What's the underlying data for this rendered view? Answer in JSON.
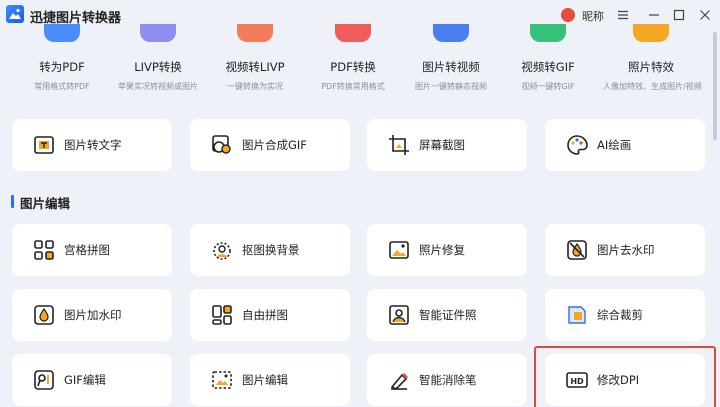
{
  "app": {
    "title": "迅捷图片转换器",
    "user_name": "昵称"
  },
  "window_controls": {
    "menu": "≡",
    "minimize": "—",
    "maximize": "□",
    "close": "✕"
  },
  "top_tools": [
    {
      "title": "转为PDF",
      "subtitle": "常用格式转PDF",
      "color": "#4a8cff"
    },
    {
      "title": "LIVP转换",
      "subtitle": "苹果实况转视频或图片",
      "color": "#8f8df0"
    },
    {
      "title": "视频转LIVP",
      "subtitle": "一键转换为实况",
      "color": "#f47c5c"
    },
    {
      "title": "PDF转换",
      "subtitle": "PDF转换常用格式",
      "color": "#f05b5b"
    },
    {
      "title": "图片转视频",
      "subtitle": "图片一键转静态视频",
      "color": "#4a7df0"
    },
    {
      "title": "视频转GIF",
      "subtitle": "视频一键转GIF",
      "color": "#37c27c"
    },
    {
      "title": "照片特效",
      "subtitle": "人像加特效、生成图片/视频",
      "color": "#f5a623"
    }
  ],
  "row1": [
    {
      "label": "图片转文字",
      "icon": "image-to-text-icon"
    },
    {
      "label": "图片合成GIF",
      "icon": "gif-compose-icon"
    },
    {
      "label": "屏幕截图",
      "icon": "screenshot-icon"
    },
    {
      "label": "AI绘画",
      "icon": "palette-icon"
    }
  ],
  "section": {
    "title": "图片编辑"
  },
  "edit_tools": [
    {
      "label": "宫格拼图",
      "icon": "grid-icon"
    },
    {
      "label": "抠图换背景",
      "icon": "cutout-icon"
    },
    {
      "label": "照片修复",
      "icon": "photo-repair-icon"
    },
    {
      "label": "图片去水印",
      "icon": "remove-watermark-icon"
    },
    {
      "label": "图片加水印",
      "icon": "add-watermark-icon"
    },
    {
      "label": "自由拼图",
      "icon": "free-collage-icon"
    },
    {
      "label": "智能证件照",
      "icon": "id-photo-icon"
    },
    {
      "label": "综合裁剪",
      "icon": "crop-icon"
    },
    {
      "label": "GIF编辑",
      "icon": "gif-edit-icon"
    },
    {
      "label": "图片编辑",
      "icon": "image-edit-icon"
    },
    {
      "label": "智能消除笔",
      "icon": "eraser-icon"
    },
    {
      "label": "修改DPI",
      "icon": "hd-icon"
    }
  ],
  "colors": {
    "accent": "#2f6bff",
    "highlight": "#d94b43",
    "background": "#eef1f8",
    "card": "#ffffff"
  }
}
